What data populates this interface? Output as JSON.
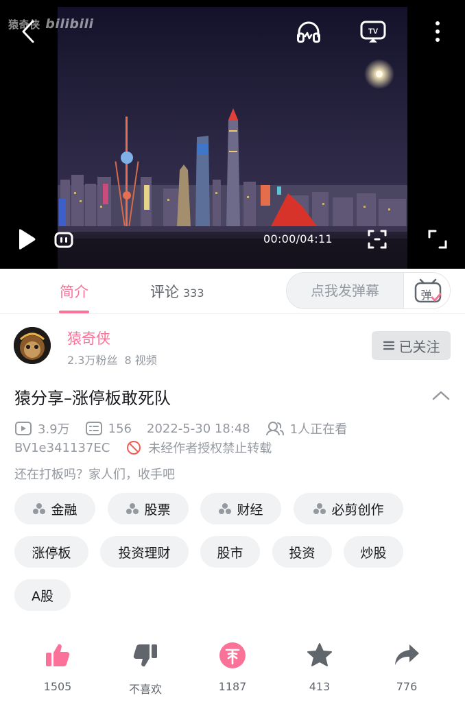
{
  "player": {
    "watermark_text": "猿奇侠",
    "watermark_brand": "bilibili",
    "time_display": "00:00/04:11",
    "icons": [
      "back-icon",
      "headphones-icon",
      "tv-cast-icon",
      "more-icon",
      "play-icon",
      "danmaku-toggle-icon",
      "screenshot-icon",
      "fullscreen-icon"
    ]
  },
  "tabs": {
    "intro_label": "简介",
    "comments_label": "评论",
    "comments_count": "333"
  },
  "danmaku": {
    "placeholder": "点我发弹幕",
    "glyph": "弹"
  },
  "author": {
    "name": "猿奇侠",
    "followers": "2.3万粉丝",
    "videos": "8 视频",
    "follow_label": "已关注"
  },
  "video": {
    "title": "猿分享–涨停板敢死队",
    "views": "3.9万",
    "danmaku_count": "156",
    "date": "2022-5-30 18:48",
    "watching": "1人正在看",
    "bvid": "BV1e341137EC",
    "copyright_notice": "未经作者授权禁止转载",
    "description": "还在打板吗？家人们，收手吧"
  },
  "tags": [
    {
      "label": "金融",
      "channel": true
    },
    {
      "label": "股票",
      "channel": true
    },
    {
      "label": "财经",
      "channel": true
    },
    {
      "label": "必剪创作",
      "channel": true
    },
    {
      "label": "涨停板",
      "channel": false
    },
    {
      "label": "投资理财",
      "channel": false
    },
    {
      "label": "股市",
      "channel": false
    },
    {
      "label": "投资",
      "channel": false
    },
    {
      "label": "炒股",
      "channel": false
    },
    {
      "label": "A股",
      "channel": false
    }
  ],
  "actions": {
    "like": "1505",
    "dislike": "不喜欢",
    "coin": "1187",
    "favorite": "413",
    "share": "776"
  },
  "colors": {
    "accent": "#fb7299",
    "text_primary": "#18191c",
    "text_secondary": "#9499a0",
    "icon_gray": "#61666d",
    "tag_bg": "#f1f2f3"
  }
}
